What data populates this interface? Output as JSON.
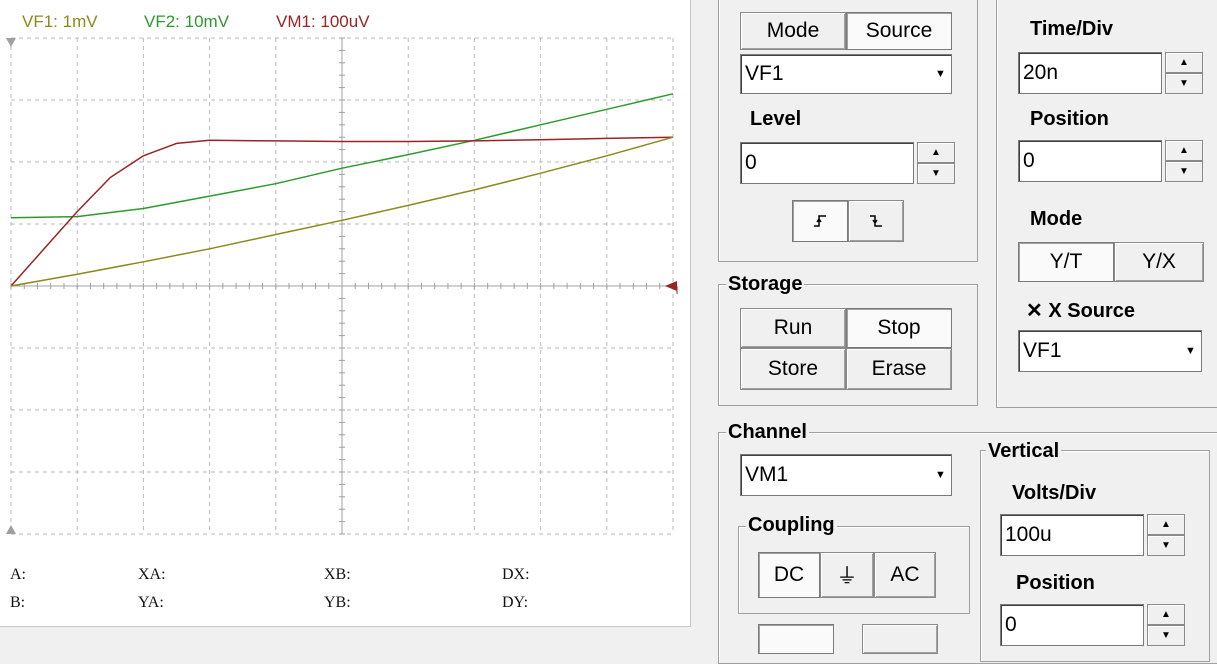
{
  "scope": {
    "labels": [
      {
        "text": "VF1: 1mV",
        "color": "#8a8a1a"
      },
      {
        "text": "VF2: 10mV",
        "color": "#2e9a2e"
      },
      {
        "text": "VM1: 100uV",
        "color": "#9a2424"
      }
    ],
    "measure": {
      "a": "A:",
      "b": "B:",
      "xa": "XA:",
      "ya": "YA:",
      "xb": "XB:",
      "yb": "YB:",
      "dx": "DX:",
      "dy": "DY:"
    }
  },
  "chart_data": {
    "type": "line",
    "grid": true,
    "series": [
      {
        "color": "#2e9a2e",
        "x": [
          0,
          1,
          2,
          3,
          4,
          5,
          6,
          7,
          8,
          9,
          10
        ],
        "y": [
          1.1,
          1.12,
          1.25,
          1.45,
          1.65,
          1.9,
          2.12,
          2.35,
          2.6,
          2.85,
          3.1
        ]
      },
      {
        "color": "#9a2424",
        "x": [
          0,
          0.5,
          1,
          1.5,
          2,
          2.5,
          3,
          4,
          5,
          6,
          7,
          8,
          9,
          10
        ],
        "y": [
          0,
          0.6,
          1.2,
          1.75,
          2.1,
          2.3,
          2.35,
          2.34,
          2.33,
          2.33,
          2.34,
          2.36,
          2.38,
          2.4
        ]
      },
      {
        "color": "#8a8a1a",
        "x": [
          0,
          1,
          2,
          3,
          4,
          5,
          6,
          7,
          8,
          9,
          10
        ],
        "y": [
          0,
          0.19,
          0.39,
          0.6,
          0.83,
          1.06,
          1.3,
          1.55,
          1.82,
          2.1,
          2.4
        ]
      }
    ],
    "xlim": [
      0,
      10
    ],
    "ylim": [
      -4,
      4
    ]
  },
  "trigger": {
    "mode_button": "Mode",
    "source_button": "Source",
    "source_value": "VF1",
    "level_label": "Level",
    "level_value": "0",
    "rising_edge_icon": "rising-edge",
    "falling_edge_icon": "falling-edge"
  },
  "timebase": {
    "time_div_label": "Time/Div",
    "time_div_value": "20n",
    "position_label": "Position",
    "position_value": "0",
    "mode_label": "Mode",
    "yt_button": "Y/T",
    "yx_button": "Y/X",
    "xsource_label": "X Source",
    "xsource_value": "VF1"
  },
  "storage": {
    "legend": "Storage",
    "run": "Run",
    "stop": "Stop",
    "store": "Store",
    "erase": "Erase"
  },
  "channel": {
    "legend": "Channel",
    "value": "VM1",
    "coupling_legend": "Coupling",
    "dc": "DC",
    "gnd": "⏚",
    "ac": "AC"
  },
  "vertical": {
    "legend": "Vertical",
    "volts_div_label": "Volts/Div",
    "volts_div_value": "100u",
    "position_label": "Position",
    "position_value": "0"
  }
}
